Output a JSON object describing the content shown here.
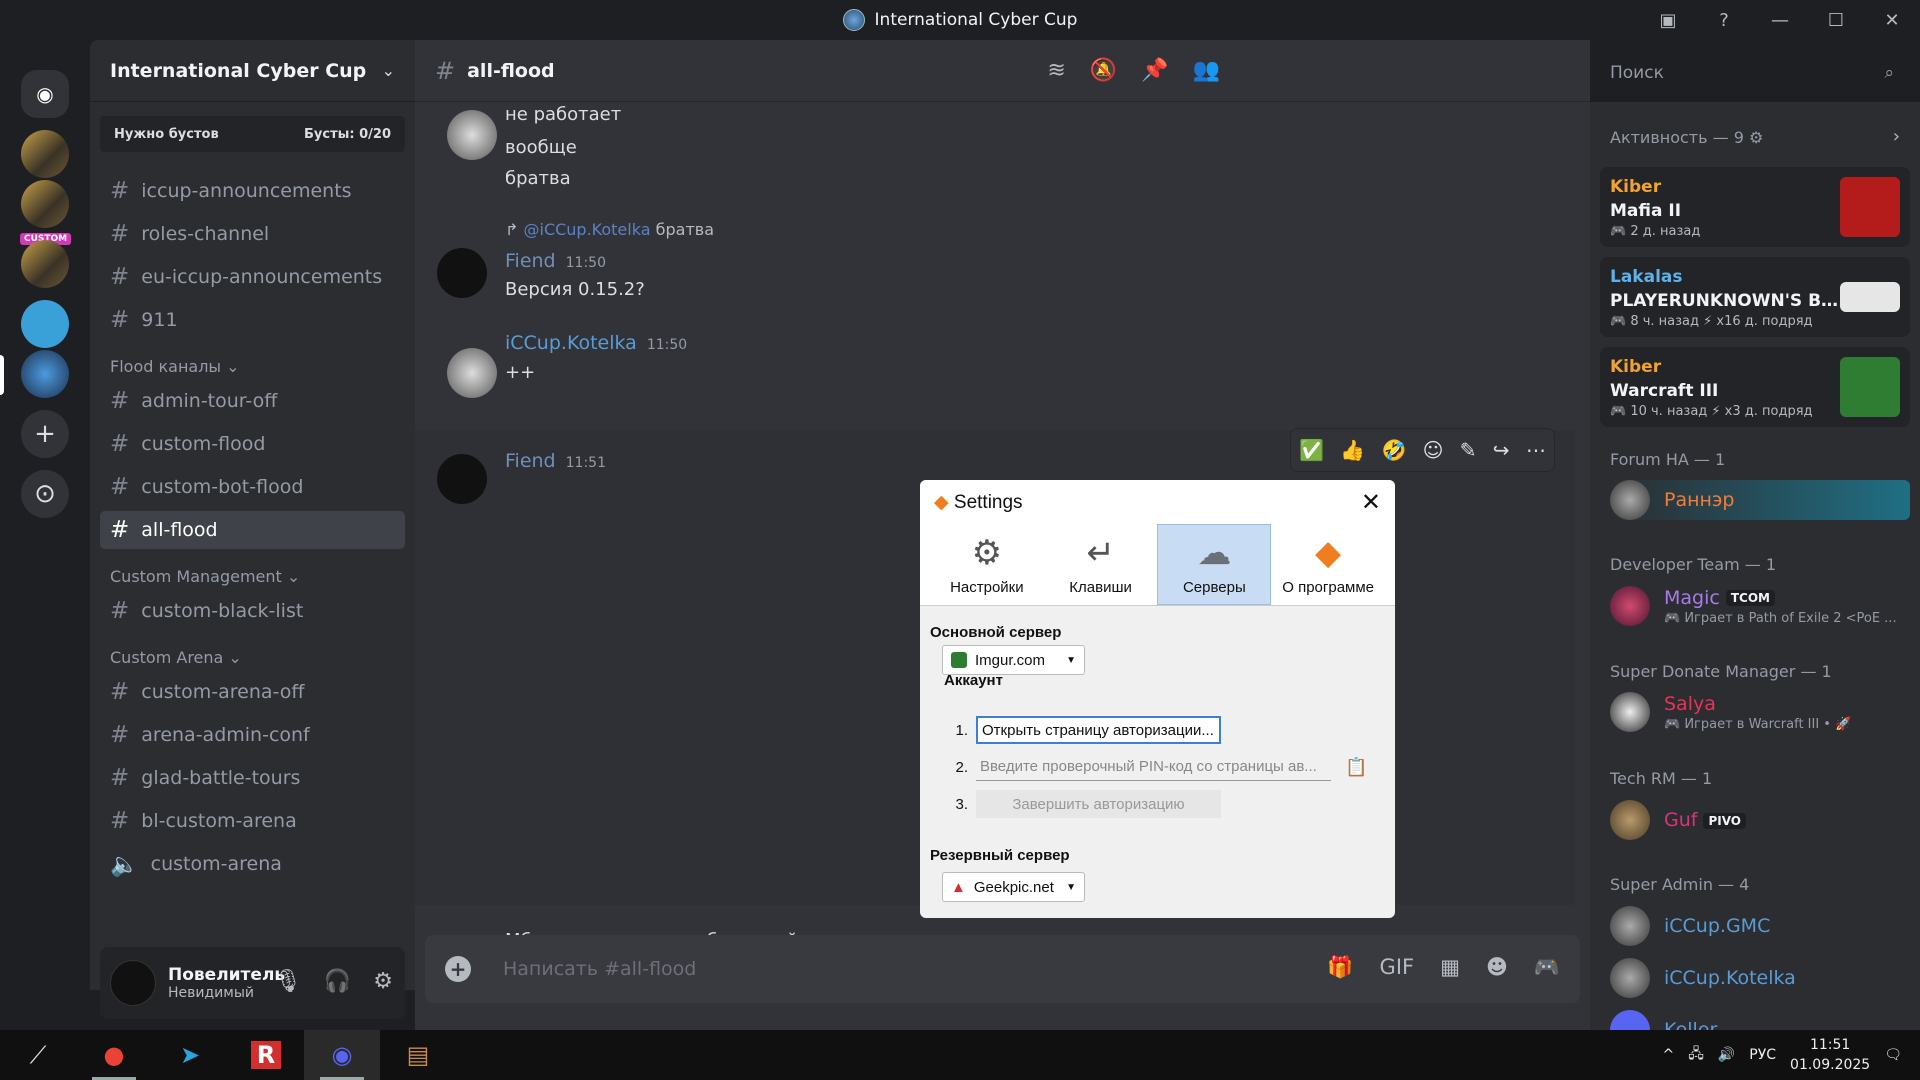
{
  "window": {
    "title": "International Cyber Cup"
  },
  "server": {
    "name": "International Cyber Cup",
    "boost_left": "Нужно бустов",
    "boost_right": "Бусты: 0/20"
  },
  "channels": {
    "top": [
      "iccup-announcements",
      "roles-channel",
      "eu-iccup-announcements",
      "911"
    ],
    "cat_flood": "Flood каналы",
    "flood": [
      "admin-tour-off",
      "custom-flood",
      "custom-bot-flood",
      "all-flood"
    ],
    "cat_mgmt": "Custom Management",
    "mgmt": [
      "custom-black-list"
    ],
    "cat_arena": "Custom Arena",
    "arena": [
      "custom-arena-off",
      "arena-admin-conf",
      "glad-battle-tours",
      "bl-custom-arena",
      "custom-arena"
    ]
  },
  "user": {
    "name": "Повелитель",
    "status": "Невидимый"
  },
  "header": {
    "channel": "all-flood",
    "search_placeholder": "Поиск"
  },
  "messages": {
    "lines_top": [
      "не работает",
      "вообще",
      "братва"
    ],
    "reply_mention": "@iCCup.Kotelka",
    "reply_text": "братва",
    "m1_author": "Fiend",
    "m1_time": "11:50",
    "m1_text": "Версия 0.15.2?",
    "m2_author": "iCCup.Kotelka",
    "m2_time": "11:50",
    "m2_text": "++",
    "m3_author": "Fiend",
    "m3_time": "11:51",
    "after_dialog": "Мб гикпик стоит у тебя на мэйне"
  },
  "dialog": {
    "title": "Settings",
    "tabs": [
      "Настройки",
      "Клавиши",
      "Серверы",
      "О программе"
    ],
    "main_server_label": "Основной сервер",
    "main_server": "Imgur.com",
    "account_label": "Аккаунт",
    "step1": "Открыть страницу авторизации...",
    "step2": "Введите проверочный PIN-код со страницы ав...",
    "step3": "Завершить авторизацию",
    "backup_label": "Резервный сервер",
    "backup_server": "Geekpic.net",
    "n1": "1.",
    "n2": "2.",
    "n3": "3."
  },
  "composer": {
    "placeholder": "Написать #all-flood"
  },
  "activity": {
    "header": "Активность — 9",
    "cards": [
      {
        "who": "Kiber",
        "game": "Mafia II",
        "meta": "🎮 2 д. назад",
        "color": "#f0a232",
        "art": "#b41b1b"
      },
      {
        "who": "Lakalas",
        "game": "PLAYERUNKNOWN'S BATT...",
        "meta": "🎮 8 ч. назад  ⚡ x16 д. подряд",
        "color": "#5fb1e8",
        "art": "#e6e6e6"
      },
      {
        "who": "Kiber",
        "game": "Warcraft III",
        "meta": "🎮 10 ч. назад  ⚡ x3 д. подряд",
        "color": "#f0a232",
        "art": "#2e7d32"
      }
    ]
  },
  "members": {
    "sec1": "Forum HA — 1",
    "m1": "Раннэр",
    "sec2": "Developer Team — 1",
    "m2": "Magic",
    "m2_badge": "TCOM",
    "m2_sub": "🎮 Играет в Path of Exile 2 <PoE ...",
    "sec3": "Super Donate Manager — 1",
    "m3": "Salya",
    "m3_sub": "🎮 Играет в Warcraft III • 🚀",
    "sec4": "Tech RM — 1",
    "m4": "Guf",
    "m4_badge": "PIVO",
    "sec5": "Super Admin — 4",
    "m5": "iCCup.GMC",
    "m6": "iCCup.Kotelka",
    "m7": "Keller"
  },
  "taskbar": {
    "lang": "РУС",
    "time": "11:51",
    "date": "01.09.2025"
  }
}
